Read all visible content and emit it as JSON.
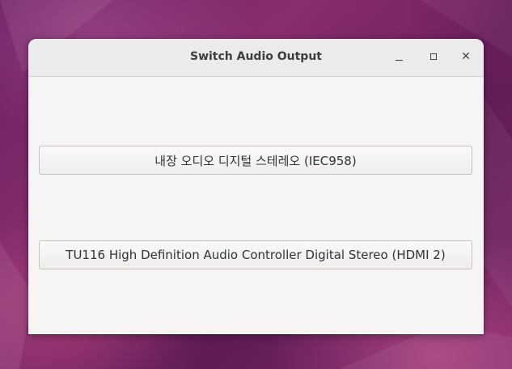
{
  "window": {
    "title": "Switch Audio Output",
    "controls": {
      "minimize": "minimize-icon",
      "maximize": "maximize-icon",
      "close": "close-icon"
    }
  },
  "outputs": [
    {
      "label": "내장 오디오 디지털 스테레오 (IEC958)"
    },
    {
      "label": "TU116 High Definition Audio Controller Digital Stereo (HDMI 2)"
    }
  ],
  "colors": {
    "desktop": "#7b2665",
    "window_bg": "#f6f5f4",
    "titlebar_bg": "#ebebeb",
    "text": "#2e3436"
  }
}
